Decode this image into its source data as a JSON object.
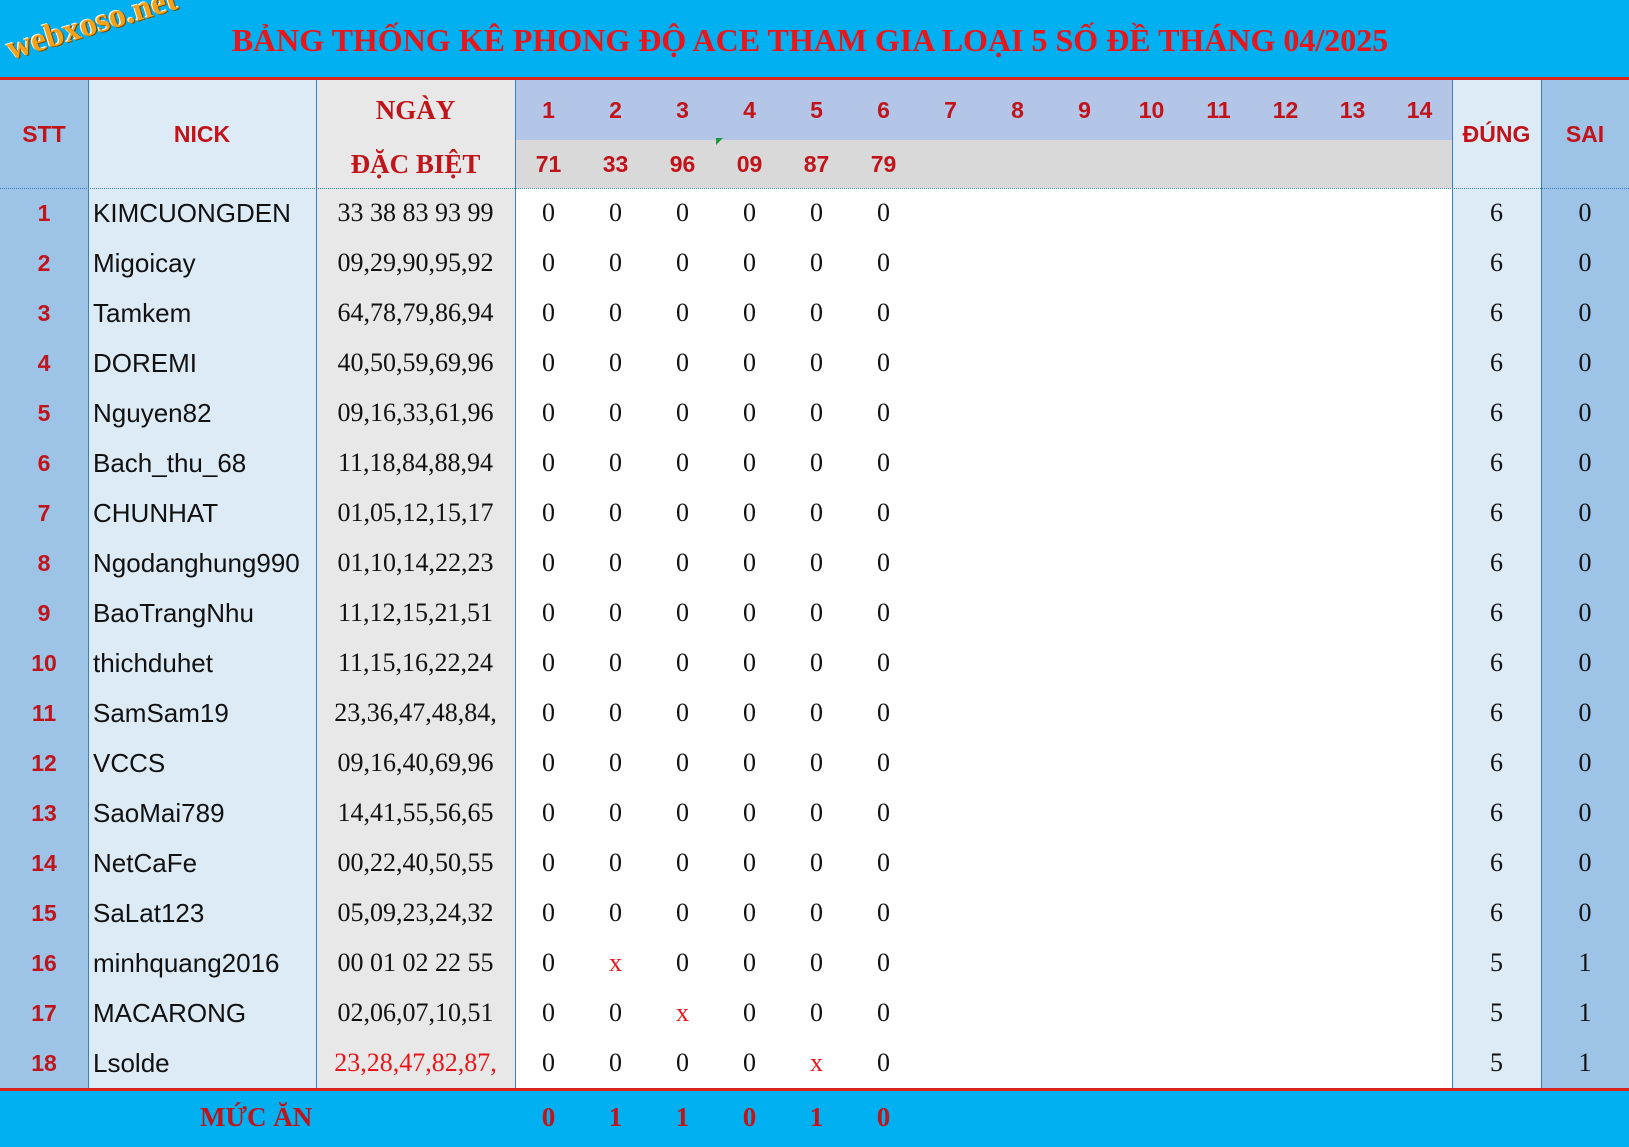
{
  "title": "BẢNG THỐNG KÊ PHONG ĐỘ ACE THAM GIA LOẠI 5 SỐ ĐỀ THÁNG 04/2025",
  "logo": "webxoso.net",
  "headers": {
    "stt": "STT",
    "nick": "NICK",
    "ngay": "NGÀY",
    "dac_biet": "ĐẶC BIỆT",
    "dung": "ĐÚNG",
    "sai": "SAI"
  },
  "day_numbers": [
    "1",
    "2",
    "3",
    "4",
    "5",
    "6",
    "7",
    "8",
    "9",
    "10",
    "11",
    "12",
    "13",
    "14"
  ],
  "results": [
    "71",
    "33",
    "96",
    "09",
    "87",
    "79"
  ],
  "rows": [
    {
      "stt": "1",
      "nick": "KIMCUONGDEN",
      "numbers": "33 38 83 93 99",
      "vals": [
        "0",
        "0",
        "0",
        "0",
        "0",
        "0"
      ],
      "dung": "6",
      "sai": "0"
    },
    {
      "stt": "2",
      "nick": "Migoicay",
      "numbers": "09,29,90,95,92",
      "vals": [
        "0",
        "0",
        "0",
        "0",
        "0",
        "0"
      ],
      "dung": "6",
      "sai": "0"
    },
    {
      "stt": "3",
      "nick": "Tamkem",
      "numbers": "64,78,79,86,94",
      "vals": [
        "0",
        "0",
        "0",
        "0",
        "0",
        "0"
      ],
      "dung": "6",
      "sai": "0"
    },
    {
      "stt": "4",
      "nick": "DOREMI",
      "numbers": "40,50,59,69,96",
      "vals": [
        "0",
        "0",
        "0",
        "0",
        "0",
        "0"
      ],
      "dung": "6",
      "sai": "0"
    },
    {
      "stt": "5",
      "nick": "Nguyen82",
      "numbers": "09,16,33,61,96",
      "vals": [
        "0",
        "0",
        "0",
        "0",
        "0",
        "0"
      ],
      "dung": "6",
      "sai": "0"
    },
    {
      "stt": "6",
      "nick": "Bach_thu_68",
      "numbers": "11,18,84,88,94",
      "vals": [
        "0",
        "0",
        "0",
        "0",
        "0",
        "0"
      ],
      "dung": "6",
      "sai": "0"
    },
    {
      "stt": "7",
      "nick": "CHUNHAT",
      "numbers": "01,05,12,15,17",
      "vals": [
        "0",
        "0",
        "0",
        "0",
        "0",
        "0"
      ],
      "dung": "6",
      "sai": "0"
    },
    {
      "stt": "8",
      "nick": "Ngodanghung990",
      "numbers": "01,10,14,22,23",
      "vals": [
        "0",
        "0",
        "0",
        "0",
        "0",
        "0"
      ],
      "dung": "6",
      "sai": "0"
    },
    {
      "stt": "9",
      "nick": "BaoTrangNhu",
      "numbers": "11,12,15,21,51",
      "vals": [
        "0",
        "0",
        "0",
        "0",
        "0",
        "0"
      ],
      "dung": "6",
      "sai": "0"
    },
    {
      "stt": "10",
      "nick": "thichduhet",
      "numbers": "11,15,16,22,24",
      "vals": [
        "0",
        "0",
        "0",
        "0",
        "0",
        "0"
      ],
      "dung": "6",
      "sai": "0"
    },
    {
      "stt": "11",
      "nick": "SamSam19",
      "numbers": "23,36,47,48,84,",
      "vals": [
        "0",
        "0",
        "0",
        "0",
        "0",
        "0"
      ],
      "dung": "6",
      "sai": "0"
    },
    {
      "stt": "12",
      "nick": "VCCS",
      "numbers": "09,16,40,69,96",
      "vals": [
        "0",
        "0",
        "0",
        "0",
        "0",
        "0"
      ],
      "dung": "6",
      "sai": "0"
    },
    {
      "stt": "13",
      "nick": "SaoMai789",
      "numbers": "14,41,55,56,65",
      "vals": [
        "0",
        "0",
        "0",
        "0",
        "0",
        "0"
      ],
      "dung": "6",
      "sai": "0"
    },
    {
      "stt": "14",
      "nick": "NetCaFe",
      "numbers": "00,22,40,50,55",
      "vals": [
        "0",
        "0",
        "0",
        "0",
        "0",
        "0"
      ],
      "dung": "6",
      "sai": "0"
    },
    {
      "stt": "15",
      "nick": "SaLat123",
      "numbers": "05,09,23,24,32",
      "vals": [
        "0",
        "0",
        "0",
        "0",
        "0",
        "0"
      ],
      "dung": "6",
      "sai": "0"
    },
    {
      "stt": "16",
      "nick": "minhquang2016",
      "numbers": "00 01 02 22 55",
      "vals": [
        "0",
        "x",
        "0",
        "0",
        "0",
        "0"
      ],
      "dung": "5",
      "sai": "1"
    },
    {
      "stt": "17",
      "nick": "MACARONG",
      "numbers": "02,06,07,10,51",
      "vals": [
        "0",
        "0",
        "x",
        "0",
        "0",
        "0"
      ],
      "dung": "5",
      "sai": "1"
    },
    {
      "stt": "18",
      "nick": "Lsolde",
      "numbers": "23,28,47,82,87,",
      "numbers_red": true,
      "vals": [
        "0",
        "0",
        "0",
        "0",
        "x",
        "0"
      ],
      "dung": "5",
      "sai": "1"
    }
  ],
  "footer": {
    "label": "MỨC ĂN",
    "values": [
      "0",
      "1",
      "1",
      "0",
      "1",
      "0"
    ]
  },
  "colors": {
    "title_bar": "#00b0f0",
    "header_text": "#c0141a",
    "accent_red": "#e8161a",
    "stt_col": "#9dc3e6",
    "nick_col": "#ddebf7",
    "ngay_col": "#e8e8e8",
    "day_header": "#b4c6e7",
    "result_row": "#d9d9d9",
    "dung_col": "#ddebf7",
    "sai_col": "#9dc3e6"
  }
}
